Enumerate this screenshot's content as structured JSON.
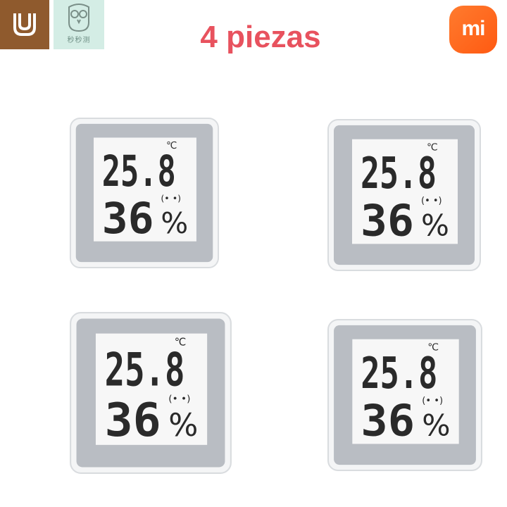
{
  "title": "4 piezas",
  "mi_logo_text": "mi",
  "owl_logo_text": "秒秒测",
  "readout": {
    "temperature": "25.8",
    "temperature_unit": "℃",
    "humidity": "36",
    "humidity_unit": "%",
    "face": "(• •)"
  },
  "colors": {
    "accent_title": "#e8525e",
    "youpin_brown": "#8f5a2d",
    "mi_orange": "#ff6a1a"
  }
}
